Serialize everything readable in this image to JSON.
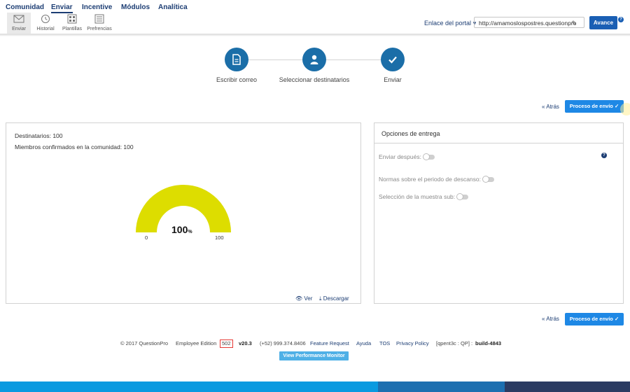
{
  "nav": {
    "tabs": [
      "Comunidad",
      "Enviar",
      "Incentive",
      "Módulos",
      "Analítica"
    ],
    "active": "Enviar"
  },
  "toolbar": {
    "items": [
      {
        "label": "Enviar",
        "icon": "envelope-icon"
      },
      {
        "label": "Historial",
        "icon": "history-icon"
      },
      {
        "label": "Plantillas",
        "icon": "templates-icon"
      },
      {
        "label": "Prefrencias",
        "icon": "preferences-icon"
      }
    ],
    "portal_link": "Enlace del portal",
    "portal_url": "http://amamoslospostres.questionpro",
    "avance_label": "Avance",
    "help_label": "?"
  },
  "steps": [
    {
      "label": "Escribir correo",
      "icon": "document-icon"
    },
    {
      "label": "Seleccionar destinatarios",
      "icon": "user-icon"
    },
    {
      "label": "Enviar",
      "icon": "check-icon"
    }
  ],
  "actions": {
    "atras_label": "Atrás",
    "proceso_label": "Proceso de envío"
  },
  "left_panel": {
    "destinatarios": "Destinatarios: 100",
    "miembros": "Miembros confirmados en la comunidad: 100",
    "gauge": {
      "value": 100,
      "min_label": "0",
      "max_label": "100",
      "value_label": "100",
      "unit": "%",
      "color": "#dddd00"
    },
    "ver_label": "Ver",
    "descargar_label": "Descargar"
  },
  "right_panel": {
    "title": "Opciones de entrega",
    "help_label": "?",
    "options": [
      {
        "label": "Enviar después:",
        "enabled": false
      },
      {
        "label": "Normas sobre el periodo de descanso:",
        "enabled": false
      },
      {
        "label": "Selección de la muestra sub:",
        "enabled": false
      }
    ]
  },
  "footer": {
    "copyright": "© 2017 QuestionPro",
    "edition": "Employee Edition",
    "code": "502",
    "version": "v20.3",
    "phone": "(+52) 999.374.8406",
    "feature_request": "Feature Request",
    "ayuda": "Ayuda",
    "tos": "TOS",
    "privacy": "Privacy Policy",
    "server": "[qpent3c : QP] :",
    "build": "build-4843",
    "perf_button": "View Performance Monitor"
  },
  "colors": {
    "primary_blue": "#1e88e5",
    "step_blue": "#1b6ea8",
    "nav_blue": "#1c3d73",
    "gauge_yellow": "#dddd00"
  }
}
